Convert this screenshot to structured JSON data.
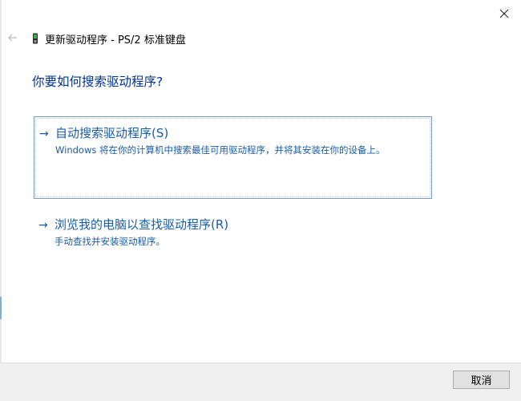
{
  "window": {
    "header_title": "更新驱动程序 - PS/2 标准键盘"
  },
  "question": "你要如何搜索驱动程序?",
  "options": [
    {
      "arrow": "→",
      "title": "自动搜索驱动程序(S)",
      "description": "Windows 将在你的计算机中搜索最佳可用驱动程序，并将其安装在你的设备上。"
    },
    {
      "arrow": "→",
      "title": "浏览我的电脑以查找驱动程序(R)",
      "description": "手动查找并安装驱动程序。"
    }
  ],
  "footer": {
    "cancel_label": "取消"
  },
  "icons": {
    "close": "close-icon",
    "back": "back-arrow-icon",
    "device": "keyboard-device-icon"
  },
  "colors": {
    "accent_blue": "#1a5ca8",
    "question_blue": "#003399",
    "footer_bg": "#f0f0f0",
    "button_bg": "#e1e1e1"
  }
}
